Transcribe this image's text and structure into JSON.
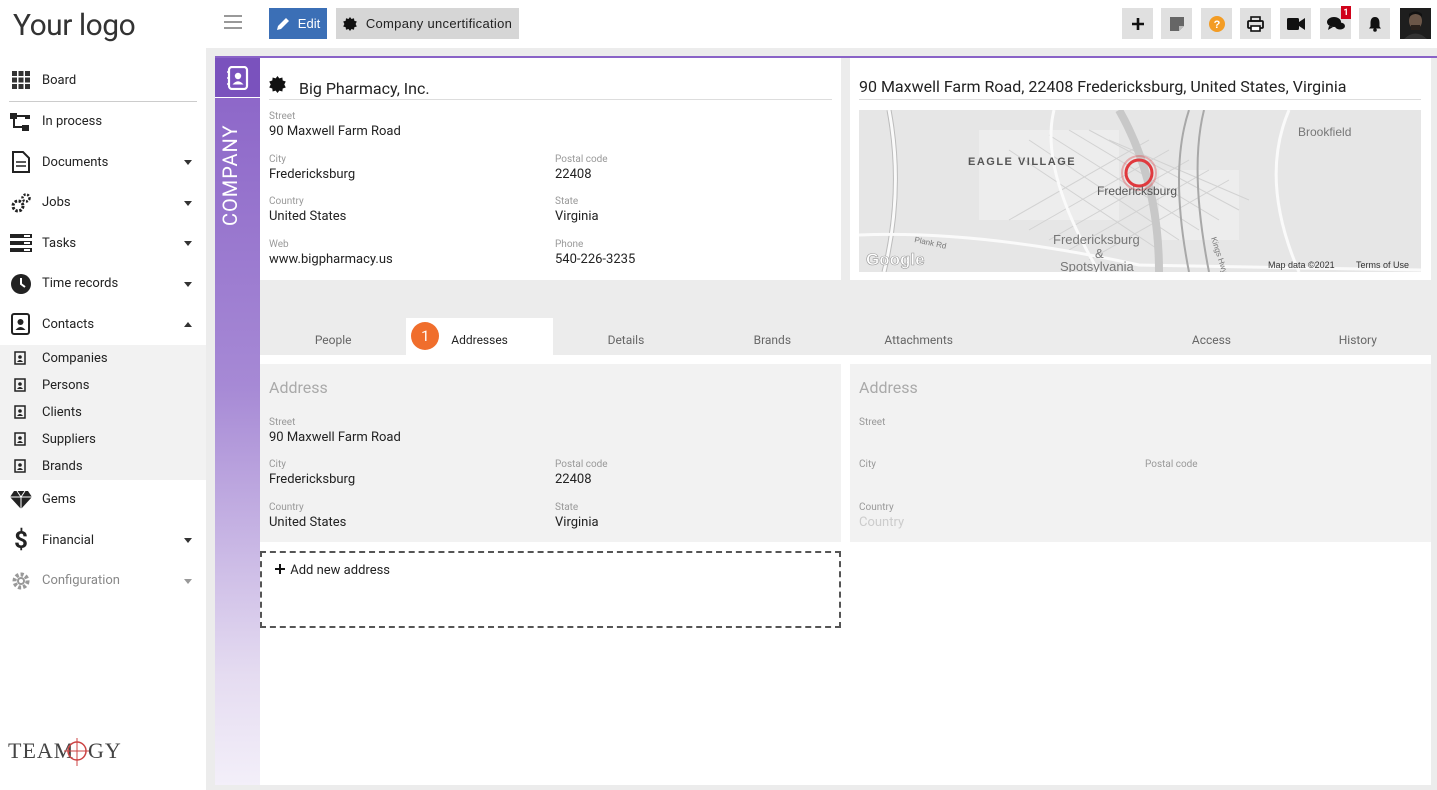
{
  "brand": {
    "logo": "Your logo",
    "footer_logo": "TEAMOGY"
  },
  "nav": {
    "board": "Board",
    "in_process": "In process",
    "documents": "Documents",
    "jobs": "Jobs",
    "tasks": "Tasks",
    "time_records": "Time records",
    "contacts": "Contacts",
    "contacts_sub": [
      "Companies",
      "Persons",
      "Clients",
      "Suppliers",
      "Brands"
    ],
    "gems": "Gems",
    "financial": "Financial",
    "configuration": "Configuration"
  },
  "toolbar": {
    "edit_label": "Edit",
    "cert_label": "Company uncertification",
    "chat_badge": "1"
  },
  "strip": {
    "label": "COMPANY"
  },
  "company": {
    "name": "Big Pharmacy, Inc.",
    "street_label": "Street",
    "street": "90  Maxwell Farm Road",
    "city_label": "City",
    "city": "Fredericksburg",
    "postal_label": "Postal code",
    "postal": "22408",
    "country_label": "Country",
    "country": "United States",
    "state_label": "State",
    "state": "Virginia",
    "web_label": "Web",
    "web": "www.bigpharmacy.us",
    "phone_label": "Phone",
    "phone": "540-226-3235"
  },
  "map": {
    "title": "90 Maxwell Farm Road, 22408 Fredericksburg, United States, Virginia",
    "labels": {
      "brookfield": "Brookfield",
      "eagle": "EAGLE VILLAGE",
      "fred": "Fredericksburg",
      "fred2": "Fredericksburg",
      "amp": "&",
      "spots": "Spotsylvania",
      "plank": "Plank Rd",
      "kings": "Kings Hwy",
      "google": "Google",
      "mapdata": "Map data ©2021",
      "terms": "Terms of Use"
    }
  },
  "tabs": [
    {
      "label": "People"
    },
    {
      "label": "Addresses",
      "step": "1"
    },
    {
      "label": "Details"
    },
    {
      "label": "Brands"
    },
    {
      "label": "Attachments"
    },
    {
      "label": ""
    },
    {
      "label": "Access"
    },
    {
      "label": "History"
    }
  ],
  "address_left": {
    "title": "Address",
    "street_label": "Street",
    "street": "90  Maxwell Farm Road",
    "city_label": "City",
    "city": "Fredericksburg",
    "postal_label": "Postal code",
    "postal": "22408",
    "country_label": "Country",
    "country": "United States",
    "state_label": "State",
    "state": "Virginia"
  },
  "address_right": {
    "title": "Address",
    "street_label": "Street",
    "city_label": "City",
    "postal_label": "Postal code",
    "country_label": "Country",
    "country_placeholder": "Country"
  },
  "add_address": {
    "label": "Add new address"
  }
}
